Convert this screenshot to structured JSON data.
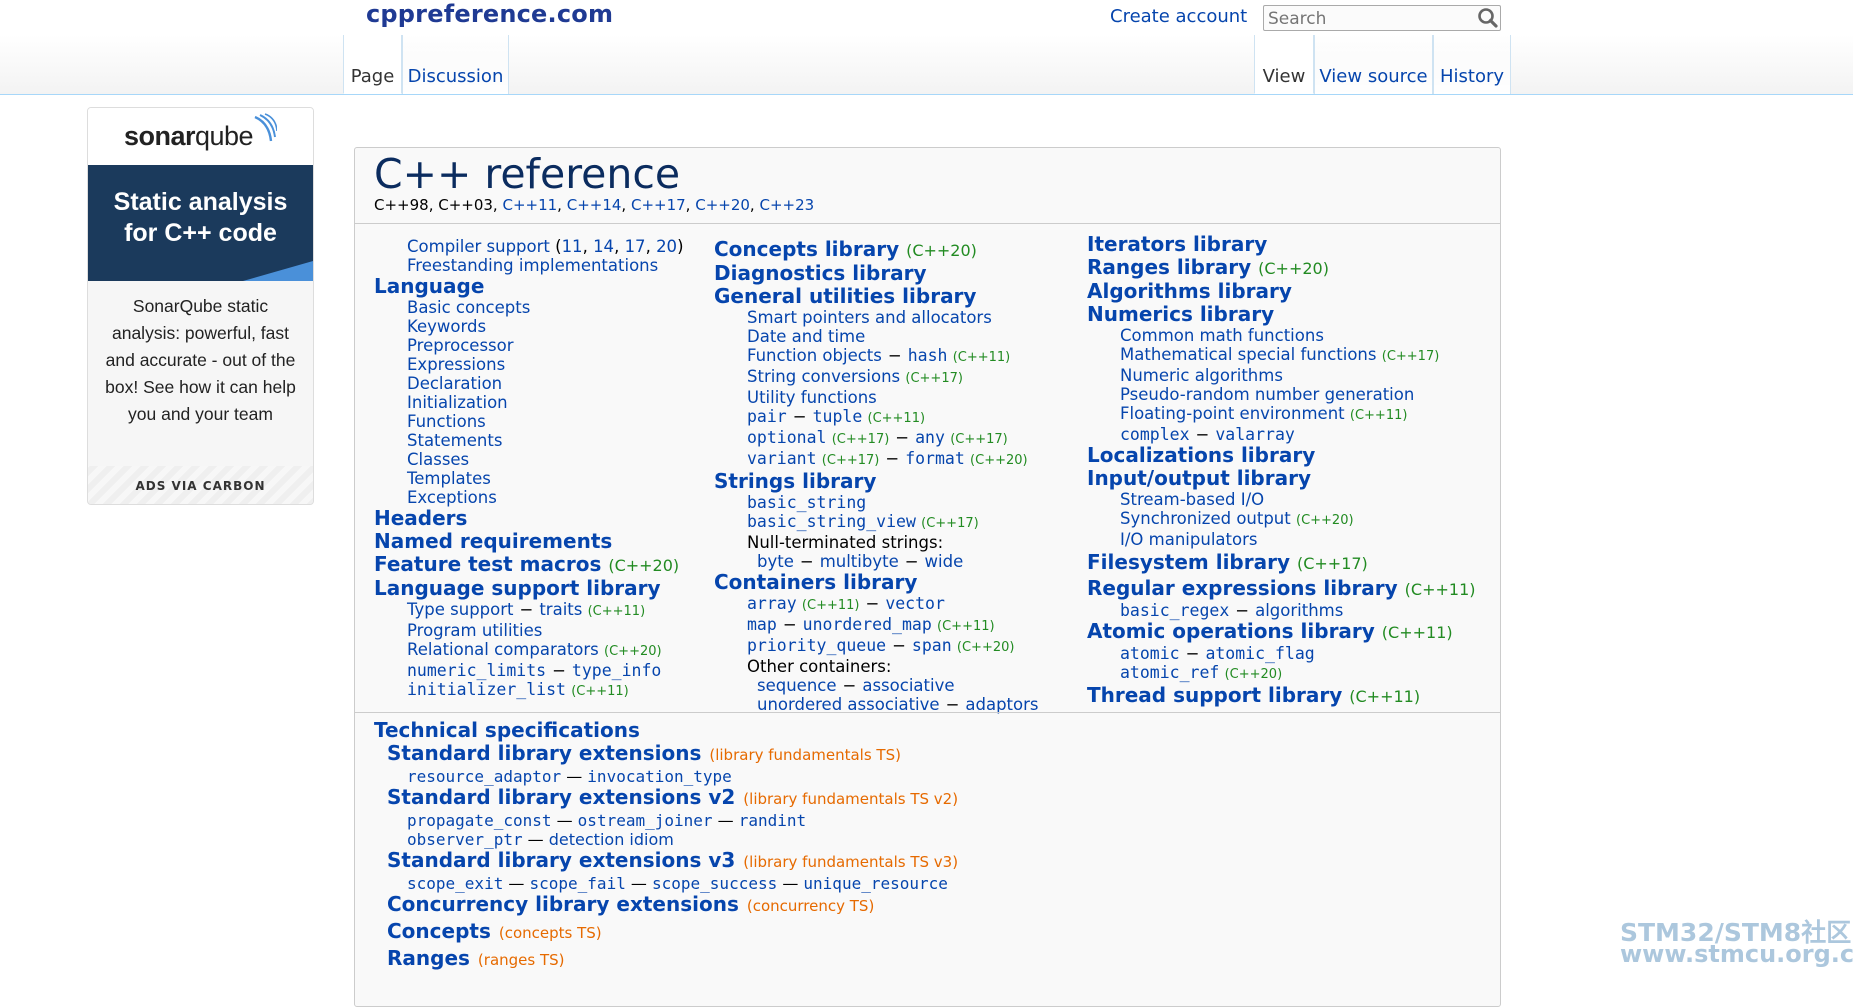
{
  "header": {
    "site_title": "cppreference.com",
    "create_account": "Create account",
    "search_placeholder": "Search",
    "tabs_left": [
      "Page",
      "Discussion"
    ],
    "tabs_right": [
      "View",
      "View source",
      "History"
    ]
  },
  "ad": {
    "logo_a": "sonar",
    "logo_b": "qube",
    "banner_line1": "Static analysis",
    "banner_line2": "for C++ code",
    "text": "SonarQube static analysis: powerful, fast and accurate - out of the box! See how it can help you and your team",
    "footer": "ADS VIA CARBON"
  },
  "page": {
    "title": "C++ reference",
    "std_prefix": "C++98, C++03, ",
    "std_links": [
      "C++11",
      "C++14",
      "C++17",
      "C++20",
      "C++23"
    ]
  },
  "col1": {
    "compiler_support": "Compiler support",
    "compiler_versions": [
      "11",
      "14",
      "17",
      "20"
    ],
    "freestanding": "Freestanding implementations",
    "language": "Language",
    "language_items": [
      "Basic concepts",
      "Keywords",
      "Preprocessor",
      "Expressions",
      "Declaration",
      "Initialization",
      "Functions",
      "Statements",
      "Classes",
      "Templates",
      "Exceptions"
    ],
    "headers": "Headers",
    "named_requirements": "Named requirements",
    "feature_test": "Feature test macros",
    "feature_test_ver": "(C++20)",
    "lang_support": "Language support library",
    "type_support": "Type support",
    "traits": "traits",
    "traits_ver": "(C++11)",
    "program_utilities": "Program utilities",
    "relational": "Relational comparators",
    "relational_ver": "(C++20)",
    "numeric_limits": "numeric_limits",
    "type_info": "type_info",
    "initializer_list": "initializer_list",
    "initializer_list_ver": "(C++11)"
  },
  "col2": {
    "concepts": "Concepts library",
    "concepts_ver": "(C++20)",
    "diagnostics": "Diagnostics library",
    "general": "General utilities library",
    "smart_ptrs": "Smart pointers and allocators",
    "date_time": "Date and time",
    "function_objects": "Function objects",
    "hash": "hash",
    "hash_ver": "(C++11)",
    "string_conv": "String conversions",
    "string_conv_ver": "(C++17)",
    "utility_functions": "Utility functions",
    "pair": "pair",
    "tuple": "tuple",
    "tuple_ver": "(C++11)",
    "optional": "optional",
    "optional_ver": "(C++17)",
    "any": "any",
    "any_ver": "(C++17)",
    "variant": "variant",
    "variant_ver": "(C++17)",
    "format": "format",
    "format_ver": "(C++20)",
    "strings": "Strings library",
    "basic_string": "basic_string",
    "basic_string_view": "basic_string_view",
    "basic_string_view_ver": "(C++17)",
    "null_terminated": "Null-terminated strings:",
    "byte": "byte",
    "multibyte": "multibyte",
    "wide": "wide",
    "containers": "Containers library",
    "array": "array",
    "array_ver": "(C++11)",
    "vector": "vector",
    "map": "map",
    "unordered_map": "unordered_map",
    "unordered_map_ver": "(C++11)",
    "priority_queue": "priority_queue",
    "span": "span",
    "span_ver": "(C++20)",
    "other_containers": "Other containers:",
    "sequence": "sequence",
    "associative": "associative",
    "unordered_associative": "unordered associative",
    "adaptors": "adaptors"
  },
  "col3": {
    "iterators": "Iterators library",
    "ranges": "Ranges library",
    "ranges_ver": "(C++20)",
    "algorithms": "Algorithms library",
    "numerics": "Numerics library",
    "common_math": "Common math functions",
    "math_special": "Mathematical special functions",
    "math_special_ver": "(C++17)",
    "numeric_algorithms": "Numeric algorithms",
    "prng": "Pseudo-random number generation",
    "fp_env": "Floating-point environment",
    "fp_env_ver": "(C++11)",
    "complex": "complex",
    "valarray": "valarray",
    "localizations": "Localizations library",
    "io": "Input/output library",
    "stream_io": "Stream-based I/O",
    "sync_output": "Synchronized output",
    "sync_output_ver": "(C++20)",
    "io_manip": "I/O manipulators",
    "filesystem": "Filesystem library",
    "filesystem_ver": "(C++17)",
    "regex": "Regular expressions library",
    "regex_ver": "(C++11)",
    "basic_regex": "basic_regex",
    "regex_algorithms": "algorithms",
    "atomic_ops": "Atomic operations library",
    "atomic_ops_ver": "(C++11)",
    "atomic": "atomic",
    "atomic_flag": "atomic_flag",
    "atomic_ref": "atomic_ref",
    "atomic_ref_ver": "(C++20)",
    "thread": "Thread support library",
    "thread_ver": "(C++11)"
  },
  "tech": {
    "title": "Technical specifications",
    "ext1": "Standard library extensions",
    "ext1_ts": "(library fundamentals TS)",
    "resource_adaptor": "resource_adaptor",
    "invocation_type": "invocation_type",
    "ext2": "Standard library extensions v2",
    "ext2_ts": "(library fundamentals TS v2)",
    "propagate_const": "propagate_const",
    "ostream_joiner": "ostream_joiner",
    "randint": "randint",
    "observer_ptr": "observer_ptr",
    "detection_idiom": "detection idiom",
    "ext3": "Standard library extensions v3",
    "ext3_ts": "(library fundamentals TS v3)",
    "scope_exit": "scope_exit",
    "scope_fail": "scope_fail",
    "scope_success": "scope_success",
    "unique_resource": "unique_resource",
    "concurrency": "Concurrency library extensions",
    "concurrency_ts": "(concurrency TS)",
    "concepts": "Concepts",
    "concepts_ts": "(concepts TS)",
    "ranges": "Ranges",
    "ranges_ts": "(ranges TS)"
  },
  "watermark": {
    "line1": "STM32/STM8社区",
    "line2": "www.stmcu.org.cn"
  },
  "colors": {
    "link": "#0645ad",
    "version": "#228b22",
    "ts": "#e66a00",
    "title": "#0b2c5f"
  },
  "icons": {
    "search": "search-icon"
  }
}
